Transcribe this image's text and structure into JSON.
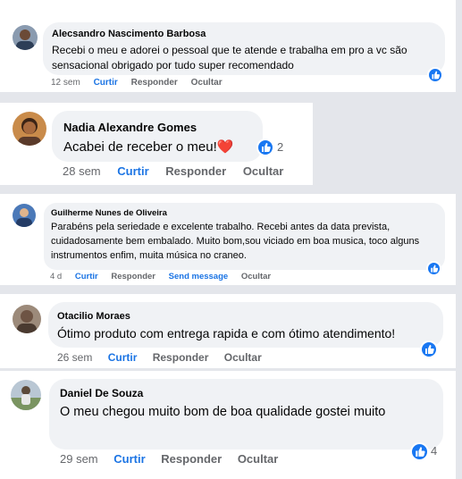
{
  "comments": [
    {
      "name": "Alecsandro Nascimento Barbosa",
      "text": "Recebi o meu e adorei o pessoal que te atende e trabalha em pro a vc são sensacional obrigado por tudo super recomendado",
      "time": "12 sem",
      "actions": [
        "Curtir",
        "Responder",
        "Ocultar"
      ]
    },
    {
      "name": "Nadia Alexandre Gomes",
      "text": "Acabei de receber o meu!",
      "emoji": "❤️",
      "reaction_count": "2",
      "time": "28 sem",
      "actions": [
        "Curtir",
        "Responder",
        "Ocultar"
      ]
    },
    {
      "name": "Guilherme Nunes de Oliveira",
      "text": "Parabéns pela seriedade e excelente trabalho. Recebi antes da data prevista, cuidadosamente bem embalado. Muito bom,sou viciado em boa musica, toco alguns instrumentos enfim, muita música no craneo.",
      "time": "4 d",
      "actions": [
        "Curtir",
        "Responder",
        "Send message",
        "Ocultar"
      ]
    },
    {
      "name": "Otacilio Moraes",
      "text": "Ótimo produto com entrega rapida e com ótimo atendimento!",
      "time": "26 sem",
      "actions": [
        "Curtir",
        "Responder",
        "Ocultar"
      ]
    },
    {
      "name": "Daniel De Souza",
      "text": "O meu chegou muito bom de boa qualidade gostei muito",
      "reaction_count": "4",
      "time": "29 sem",
      "actions": [
        "Curtir",
        "Responder",
        "Ocultar"
      ]
    }
  ],
  "colors": {
    "link": "#1b74e4",
    "like": "#1877f2",
    "bubble": "#f0f2f5",
    "meta": "#65676b"
  },
  "icons": {
    "reaction": "thumbs-up-icon",
    "emoji": "red-heart"
  }
}
